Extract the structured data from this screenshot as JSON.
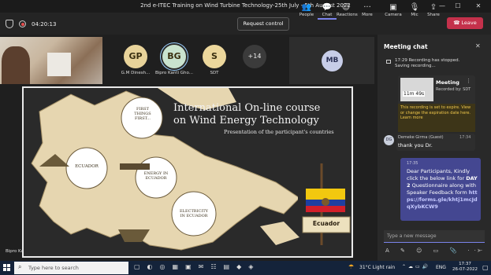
{
  "window": {
    "title": "2nd e-ITEC Training on Wind Turbine Technology-25th July - 5th August 2022",
    "minimize": "—",
    "maximize": "☐",
    "close": "✕"
  },
  "toolbar": {
    "timer": "04:20:13",
    "request_control": "Request control",
    "people": "People",
    "chat": "Chat",
    "reactions": "Reactions",
    "more": "More",
    "camera": "Camera",
    "mic": "Mic",
    "share": "Share",
    "leave": "Leave"
  },
  "participants": [
    {
      "initials": "GP",
      "name": "G.M Dinesh...",
      "color": "#e8d39a"
    },
    {
      "initials": "BG",
      "name": "Bipro Kanti Gho...",
      "color": "#c9e3cf"
    },
    {
      "initials": "S",
      "name": "SDT",
      "color": "#ecd79c"
    }
  ],
  "overflow_count": "+14",
  "mb_avatar": "MB",
  "presenter_label": "Bipro Ka",
  "chat": {
    "header": "Meeting chat",
    "sys_time": "17:29",
    "sys_msg1": "Recording has stopped.",
    "sys_msg2": "Saving recording...",
    "rec_title": "Meeting",
    "rec_by": "Recorded by: SDT",
    "rec_dur": "11m 49s",
    "rec_warning": "This recording is set to expire. View or change the expiration date here. Learn more",
    "msg1_avatar": "DG",
    "msg1_author": "Demeke Girma (Guest)",
    "msg1_time": "17:34",
    "msg1_text": "thank you Dr.",
    "msg2_time": "17:35",
    "msg2_text_a": "Dear Participants, Kindly click the below link for ",
    "msg2_bold": "DAY 2",
    "msg2_text_b": " Questionnaire along with Speaker Feedback form",
    "msg2_link": "https://forms.gle/khtj1mcJdqXybKCW9",
    "input_placeholder": "Type a new message"
  },
  "slide": {
    "title1": "International On-line course",
    "title2": "on Wind Energy Technology",
    "subtitle": "Presentation of the participant's countries",
    "c1a": "FIRST",
    "c1b": "THINGS",
    "c1c": "FIRST...",
    "c2": "ECUADOR",
    "c3a": "ENERGY IN",
    "c3b": "ECUADOR",
    "c4a": "ELECTRICITY",
    "c4b": "IN ECUADOR",
    "flag_label": "Ecuador"
  },
  "taskbar": {
    "search_placeholder": "Type here to search",
    "weather": "31°C  Light rain",
    "lang": "ENG",
    "time": "17:37",
    "date": "26-07-2022"
  },
  "colors": {
    "leave": "#c4314b",
    "accent": "#7b83eb",
    "chat_bubble_self": "#444791",
    "warning_bg": "#3d3518"
  }
}
